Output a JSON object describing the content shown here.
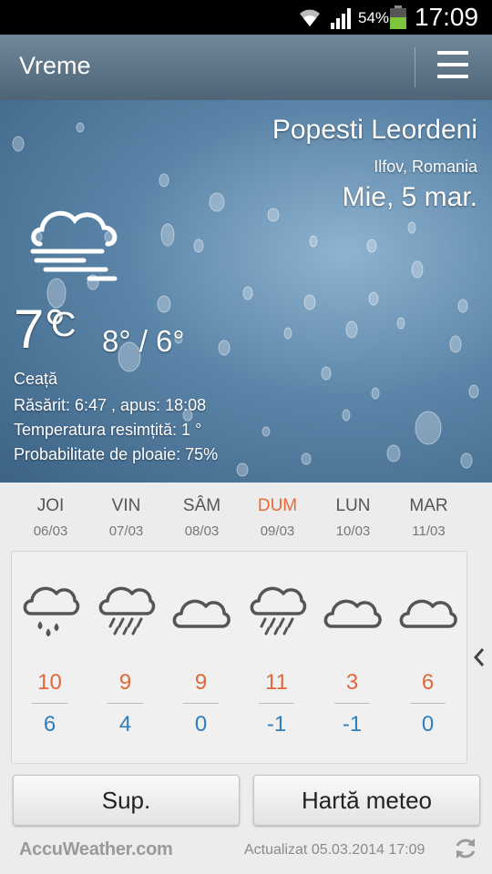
{
  "status_bar": {
    "battery_percent": "54%",
    "time": "17:09",
    "icons": [
      "wifi-icon",
      "signal-icon",
      "battery-icon"
    ]
  },
  "app_bar": {
    "title": "Vreme",
    "menu_icon": "menu-icon"
  },
  "current": {
    "city": "Popesti Leordeni",
    "region": "Ilfov, Romania",
    "date": "Mie, 5 mar.",
    "icon": "fog-cloud-icon",
    "temperature": "7°",
    "unit": "C",
    "high_low": "8° / 6°",
    "description": "Ceață",
    "sunrise_sunset": "Răsărit: 6:47 , apus: 18:08",
    "feels_like": "Temperatura resimțită: 1 °",
    "rain_probability": "Probabilitate de ploaie: 75%"
  },
  "forecast": [
    {
      "day": "JOI",
      "date": "06/03",
      "icon": "cloud-rain-drops-icon",
      "high": "10",
      "low": "6"
    },
    {
      "day": "VIN",
      "date": "07/03",
      "icon": "cloud-showers-icon",
      "high": "9",
      "low": "4"
    },
    {
      "day": "SÂM",
      "date": "08/03",
      "icon": "cloud-icon",
      "high": "9",
      "low": "0"
    },
    {
      "day": "DUM",
      "date": "09/03",
      "icon": "cloud-showers-icon",
      "high": "11",
      "low": "-1"
    },
    {
      "day": "LUN",
      "date": "10/03",
      "icon": "cloud-icon",
      "high": "3",
      "low": "-1"
    },
    {
      "day": "MAR",
      "date": "11/03",
      "icon": "cloud-icon",
      "high": "6",
      "low": "0"
    }
  ],
  "buttons": {
    "sup": "Sup.",
    "map": "Hartă meteo"
  },
  "footer": {
    "logo": "AccuWeather.com",
    "updated": "Actualizat 05.03.2014 17:09",
    "refresh_icon": "refresh-icon"
  },
  "colors": {
    "high_temp": "#e0683a",
    "low_temp": "#2f7fc0",
    "weekend_day": "#e86a35"
  }
}
